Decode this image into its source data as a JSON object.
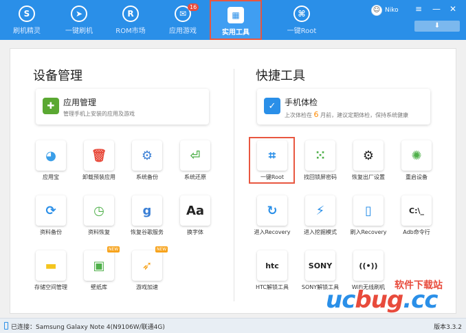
{
  "nav": [
    {
      "label": "刷机精灵",
      "icon": "shield-icon",
      "glyph": "S"
    },
    {
      "label": "一键刷机",
      "icon": "cursor-icon",
      "glyph": "➤"
    },
    {
      "label": "ROM市场",
      "icon": "rom-icon",
      "glyph": "R"
    },
    {
      "label": "应用游戏",
      "icon": "mail-icon",
      "glyph": "✉",
      "badge": "16"
    },
    {
      "label": "实用工具",
      "icon": "grid-icon",
      "glyph": "▦"
    },
    {
      "label": "一键Root",
      "icon": "root-icon",
      "glyph": "⌘"
    }
  ],
  "user": {
    "name": "Niko"
  },
  "window": {
    "menu": "≡",
    "minimize": "—",
    "close": "✕",
    "download": "⬇"
  },
  "device": {
    "title": "设备管理",
    "card": {
      "title": "应用管理",
      "subtitle": "管理手机上安装的应用及游戏"
    },
    "tiles": [
      {
        "label": "应用宝",
        "icon": "app-store-icon",
        "glyph": "◕",
        "color": "#3a9ee8"
      },
      {
        "label": "卸载预装应用",
        "icon": "trash-icon",
        "glyph": "🗑",
        "color": "#e84b3c"
      },
      {
        "label": "系统备份",
        "icon": "system-backup-icon",
        "glyph": "⚙",
        "color": "#3a7fd5"
      },
      {
        "label": "系统还原",
        "icon": "system-restore-icon",
        "glyph": "⏎",
        "color": "#4fb04a"
      },
      {
        "label": "资料备份",
        "icon": "sync-icon",
        "glyph": "⟳",
        "color": "#2a8fe8"
      },
      {
        "label": "资料恢复",
        "icon": "clock-restore-icon",
        "glyph": "◷",
        "color": "#4fb04a"
      },
      {
        "label": "恢复谷歌服务",
        "icon": "google-icon",
        "glyph": "g",
        "color": "#3a7fd5"
      },
      {
        "label": "换字体",
        "icon": "font-icon",
        "glyph": "Aa",
        "color": "#222222"
      },
      {
        "label": "存储空间管理",
        "icon": "folder-icon",
        "glyph": "▬",
        "color": "#f4c51e"
      },
      {
        "label": "壁纸库",
        "icon": "image-icon",
        "glyph": "▣",
        "color": "#4fb04a",
        "badge": "NEW"
      },
      {
        "label": "游戏加速",
        "icon": "rocket-icon",
        "glyph": "➶",
        "color": "#f7a31c",
        "badge": "NEW"
      }
    ]
  },
  "quick": {
    "title": "快捷工具",
    "card": {
      "title": "手机体检",
      "sub_prefix": "上次体检在",
      "sub_highlight": "6",
      "sub_suffix": "月前，建议定期体检，保持系统健康"
    },
    "tiles": [
      {
        "label": "一键Root",
        "icon": "android-root-icon",
        "glyph": "⌗",
        "color": "#2a8fe8"
      },
      {
        "label": "找回锁屏密码",
        "icon": "pattern-lock-icon",
        "glyph": "⁙",
        "color": "#4fb04a"
      },
      {
        "label": "恢复出厂设置",
        "icon": "gears-icon",
        "glyph": "⚙",
        "color": "#222222"
      },
      {
        "label": "重启设备",
        "icon": "reboot-icon",
        "glyph": "✺",
        "color": "#4fb04a"
      },
      {
        "label": "进入Recovery",
        "icon": "refresh-icon",
        "glyph": "↻",
        "color": "#2a8fe8"
      },
      {
        "label": "进入挖掘模式",
        "icon": "lightning-icon",
        "glyph": "⚡",
        "color": "#2a8fe8"
      },
      {
        "label": "刷入Recovery",
        "icon": "tablet-icon",
        "glyph": "▯",
        "color": "#2a8fe8"
      },
      {
        "label": "Adb命令行",
        "icon": "terminal-icon",
        "glyph": "C:\\_",
        "color": "#222222"
      },
      {
        "label": "HTC解锁工具",
        "icon": "htc-lock-icon",
        "glyph": "htc",
        "color": "#222222"
      },
      {
        "label": "SONY解锁工具",
        "icon": "sony-lock-icon",
        "glyph": "SONY",
        "color": "#222222"
      },
      {
        "label": "WiFi无线刷机",
        "icon": "wifi-icon",
        "glyph": "((•))",
        "color": "#222222"
      }
    ]
  },
  "status": {
    "connection": "已连接：Samsung Galaxy Note 4(N9106W/联通4G)",
    "version": "版本3.3.2"
  },
  "watermark": {
    "cn": "软件下载站",
    "prefix": "uc",
    "brand": "bug",
    "suffix": ".cc"
  }
}
